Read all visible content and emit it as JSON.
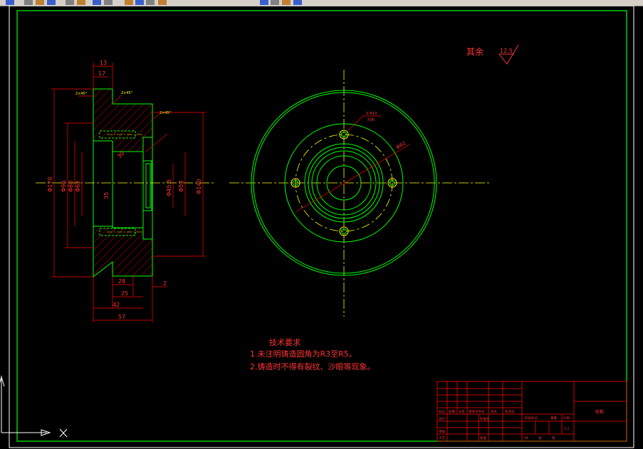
{
  "toolbar": {
    "icons": [
      "open-icon",
      "save-icon",
      "print-icon",
      "cut-icon",
      "copy-icon",
      "paste-icon",
      "undo-icon",
      "redo-icon",
      "pan-icon",
      "zoom-icon",
      "zoom-window-icon",
      "zoom-previous-icon",
      "properties-icon",
      "design-center-icon",
      "tool-palette-icon",
      "layer-icon"
    ]
  },
  "drawing": {
    "roughness_label": "其余",
    "roughness_value": "12.5",
    "notes_title": "技术要求",
    "notes": [
      "1.未注明铸造圆角为R3至R5。",
      "2.铸造时不得有裂纹、沙眼等现象。"
    ],
    "dims_top": [
      "13",
      "17"
    ],
    "dims_bottom": [
      "28",
      "25",
      "42",
      "57",
      "2"
    ],
    "dims_left": [
      "Φ170",
      "Φ96",
      "Φ80",
      "Φ62"
    ],
    "dims_right": [
      "Φ45.5",
      "Φ54",
      "Φ140"
    ],
    "section_labels": [
      "35",
      "30"
    ],
    "pcd_label": "Φ82",
    "hole_label": "3-Φ10",
    "hole_note": "均布",
    "chamfer_labels": [
      "2×45°",
      "2×45°",
      "2×45°"
    ]
  },
  "title_block": {
    "part_name": "轮毂",
    "cells": [
      "标记",
      "处数",
      "分区",
      "更改文件号",
      "签名",
      "年月日",
      "设计",
      "标准化",
      "审核",
      "工艺",
      "批准",
      "阶段标记",
      "重量",
      "比例",
      "共",
      "张",
      "第",
      "1:2"
    ]
  },
  "colors": {
    "frame": "#00ff00",
    "geometry": "#00ff00",
    "centerline": "#ffff00",
    "dimension": "#ff0000",
    "hatch": "#ff0000",
    "text": "#ff3333",
    "background": "#000000"
  }
}
